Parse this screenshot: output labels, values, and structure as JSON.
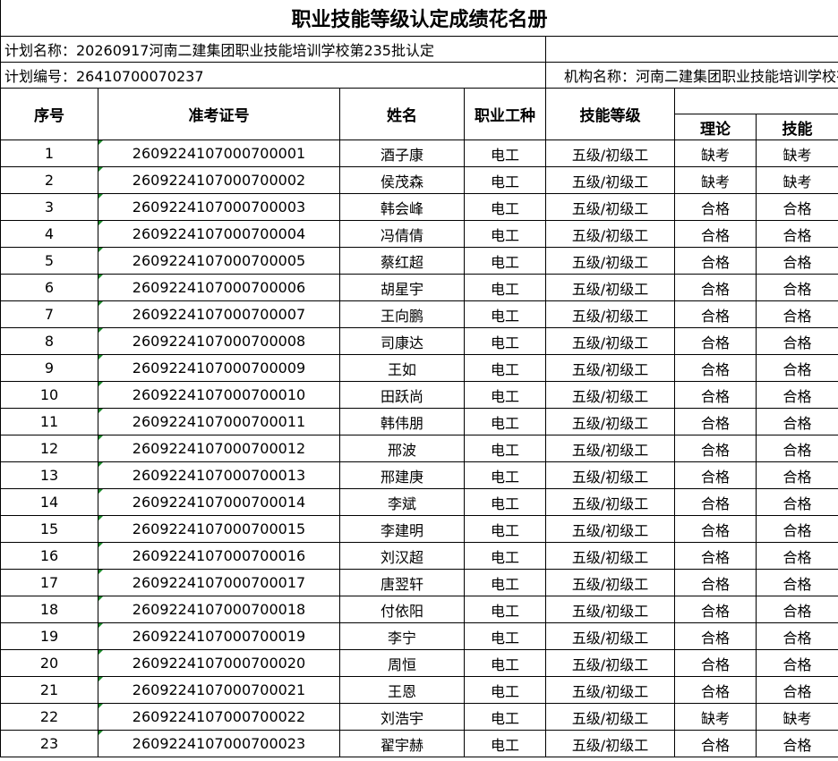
{
  "title": "职业技能等级认定成绩花名册",
  "plan_name": "计划名称：20260917河南二建集团职业技能培训学校第235批认定",
  "plan_number": "计划编号：26410700070237",
  "org_name": "机构名称：河南二建集团职业技能培训学校有限公司",
  "headers": {
    "seq": "序号",
    "exam_id": "准考证号",
    "name": "姓名",
    "occupation": "职业工种",
    "level": "技能等级",
    "theory": "理论",
    "skill": "技能"
  },
  "rows": [
    {
      "seq": "1",
      "exam_id": "2609224107000700001",
      "name": "酒子康",
      "occupation": "电工",
      "level": "五级/初级工",
      "theory": "缺考",
      "skill": "缺考"
    },
    {
      "seq": "2",
      "exam_id": "2609224107000700002",
      "name": "侯茂森",
      "occupation": "电工",
      "level": "五级/初级工",
      "theory": "缺考",
      "skill": "缺考"
    },
    {
      "seq": "3",
      "exam_id": "2609224107000700003",
      "name": "韩会峰",
      "occupation": "电工",
      "level": "五级/初级工",
      "theory": "合格",
      "skill": "合格"
    },
    {
      "seq": "4",
      "exam_id": "2609224107000700004",
      "name": "冯倩倩",
      "occupation": "电工",
      "level": "五级/初级工",
      "theory": "合格",
      "skill": "合格"
    },
    {
      "seq": "5",
      "exam_id": "2609224107000700005",
      "name": "蔡红超",
      "occupation": "电工",
      "level": "五级/初级工",
      "theory": "合格",
      "skill": "合格"
    },
    {
      "seq": "6",
      "exam_id": "2609224107000700006",
      "name": "胡星宇",
      "occupation": "电工",
      "level": "五级/初级工",
      "theory": "合格",
      "skill": "合格"
    },
    {
      "seq": "7",
      "exam_id": "2609224107000700007",
      "name": "王向鹏",
      "occupation": "电工",
      "level": "五级/初级工",
      "theory": "合格",
      "skill": "合格"
    },
    {
      "seq": "8",
      "exam_id": "2609224107000700008",
      "name": "司康达",
      "occupation": "电工",
      "level": "五级/初级工",
      "theory": "合格",
      "skill": "合格"
    },
    {
      "seq": "9",
      "exam_id": "2609224107000700009",
      "name": "王如",
      "occupation": "电工",
      "level": "五级/初级工",
      "theory": "合格",
      "skill": "合格"
    },
    {
      "seq": "10",
      "exam_id": "2609224107000700010",
      "name": "田跃尚",
      "occupation": "电工",
      "level": "五级/初级工",
      "theory": "合格",
      "skill": "合格"
    },
    {
      "seq": "11",
      "exam_id": "2609224107000700011",
      "name": "韩伟朋",
      "occupation": "电工",
      "level": "五级/初级工",
      "theory": "合格",
      "skill": "合格"
    },
    {
      "seq": "12",
      "exam_id": "2609224107000700012",
      "name": "邢波",
      "occupation": "电工",
      "level": "五级/初级工",
      "theory": "合格",
      "skill": "合格"
    },
    {
      "seq": "13",
      "exam_id": "2609224107000700013",
      "name": "邢建庚",
      "occupation": "电工",
      "level": "五级/初级工",
      "theory": "合格",
      "skill": "合格"
    },
    {
      "seq": "14",
      "exam_id": "2609224107000700014",
      "name": "李斌",
      "occupation": "电工",
      "level": "五级/初级工",
      "theory": "合格",
      "skill": "合格"
    },
    {
      "seq": "15",
      "exam_id": "2609224107000700015",
      "name": "李建明",
      "occupation": "电工",
      "level": "五级/初级工",
      "theory": "合格",
      "skill": "合格"
    },
    {
      "seq": "16",
      "exam_id": "2609224107000700016",
      "name": "刘汉超",
      "occupation": "电工",
      "level": "五级/初级工",
      "theory": "合格",
      "skill": "合格"
    },
    {
      "seq": "17",
      "exam_id": "2609224107000700017",
      "name": "唐翌轩",
      "occupation": "电工",
      "level": "五级/初级工",
      "theory": "合格",
      "skill": "合格"
    },
    {
      "seq": "18",
      "exam_id": "2609224107000700018",
      "name": "付依阳",
      "occupation": "电工",
      "level": "五级/初级工",
      "theory": "合格",
      "skill": "合格"
    },
    {
      "seq": "19",
      "exam_id": "2609224107000700019",
      "name": "李宁",
      "occupation": "电工",
      "level": "五级/初级工",
      "theory": "合格",
      "skill": "合格"
    },
    {
      "seq": "20",
      "exam_id": "2609224107000700020",
      "name": "周恒",
      "occupation": "电工",
      "level": "五级/初级工",
      "theory": "合格",
      "skill": "合格"
    },
    {
      "seq": "21",
      "exam_id": "2609224107000700021",
      "name": "王恩",
      "occupation": "电工",
      "level": "五级/初级工",
      "theory": "合格",
      "skill": "合格"
    },
    {
      "seq": "22",
      "exam_id": "2609224107000700022",
      "name": "刘浩宇",
      "occupation": "电工",
      "level": "五级/初级工",
      "theory": "缺考",
      "skill": "缺考"
    },
    {
      "seq": "23",
      "exam_id": "2609224107000700023",
      "name": "翟宇赫",
      "occupation": "电工",
      "level": "五级/初级工",
      "theory": "合格",
      "skill": "合格"
    }
  ]
}
